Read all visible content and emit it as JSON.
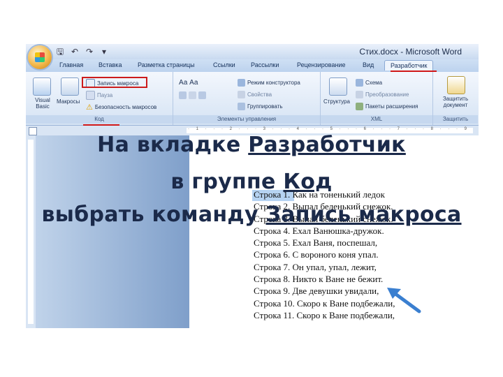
{
  "window": {
    "title": "Стих.docx - Microsoft Word"
  },
  "tabs": [
    {
      "label": "Главная"
    },
    {
      "label": "Вставка"
    },
    {
      "label": "Разметка страницы"
    },
    {
      "label": "Ссылки"
    },
    {
      "label": "Рассылки"
    },
    {
      "label": "Рецензирование"
    },
    {
      "label": "Вид"
    },
    {
      "label": "Разработчик"
    }
  ],
  "ribbon": {
    "code": {
      "label": "Код",
      "visual_basic": "Visual Basic",
      "macros": "Макросы",
      "record_macro": "Запись макроса",
      "pause": "Пауза",
      "macro_security": "Безопасность макросов"
    },
    "controls": {
      "label": "Элементы управления",
      "design_mode": "Режим конструктора",
      "properties": "Свойства",
      "group": "Группировать"
    },
    "xml": {
      "label": "XML",
      "structure": "Структура",
      "schema": "Схема",
      "transform": "Преобразование",
      "packs": "Пакеты расширения"
    },
    "protect": {
      "label": "Защитить",
      "protect_doc": "Защитить документ"
    }
  },
  "document": {
    "lines": [
      "Строка 1. Как на тоненький ледок",
      "Строка 2. Выпал беленький снежок.",
      "Строка 3. Выпал беленький снежок.",
      "Строка 4. Ехал Ванюшка-дружок.",
      "Строка 5. Ехал Ваня, поспешал,",
      "Строка 6. С вороного коня упал.",
      "Строка 7. Он упал, упал, лежит,",
      "Строка 8. Никто к Ване не бежит.",
      "Строка 9. Две девушки увидали,",
      "Строка 10. Скоро к Ване подбежали,",
      "Строка 11. Скоро к Ване подбежали,"
    ]
  },
  "caption": {
    "line1_pre": "На вкладке ",
    "line1_u": "Разработчик",
    "line2_pre": "в группе ",
    "line2_u": "Код",
    "line3_pre": "выбрать команду ",
    "line3_u": "Запись макроса"
  },
  "colors": {
    "highlight_red": "#cc1b1b",
    "caption_text": "#1b2a4a",
    "arrow_blue": "#3a7fd0"
  }
}
